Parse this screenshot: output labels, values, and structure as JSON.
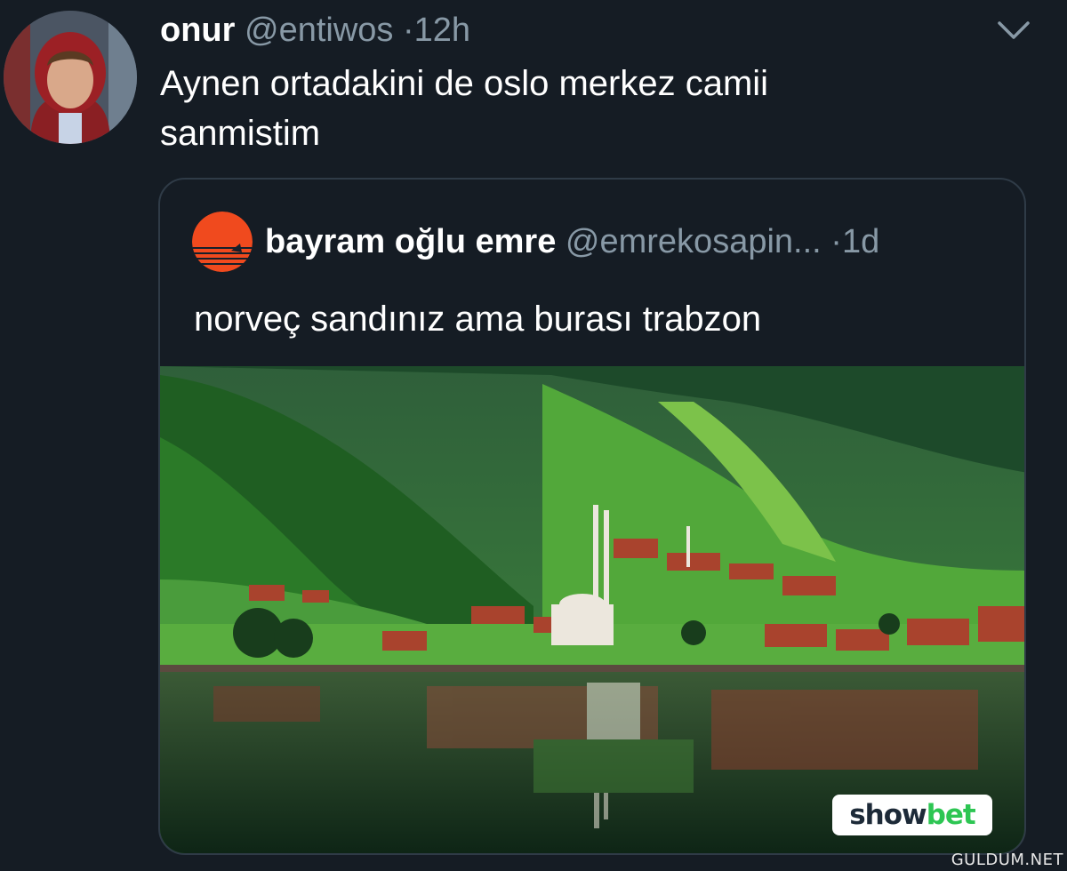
{
  "tweet": {
    "author_name": "onur",
    "author_handle": "@entiwos",
    "separator": "·",
    "time": "12h",
    "text_line1": "Aynen ortadakini de oslo merkez camii",
    "text_line2": "sanmistim",
    "menu_icon": "chevron-down-icon"
  },
  "quoted_tweet": {
    "author_name": "bayram oğlu emre",
    "author_handle": "@emrekosapin...",
    "separator": "·",
    "time": "1d",
    "text": "norveç sandınız ama burası trabzon"
  },
  "overlay": {
    "logo_part1": "show",
    "logo_part2": "bet",
    "watermark": "GULDUM.NET"
  },
  "colors": {
    "background": "#151c24",
    "muted_text": "#8899a6",
    "border": "#2f3b47",
    "logo_green": "#2dc653",
    "quote_avatar_orange": "#f04a1e"
  }
}
